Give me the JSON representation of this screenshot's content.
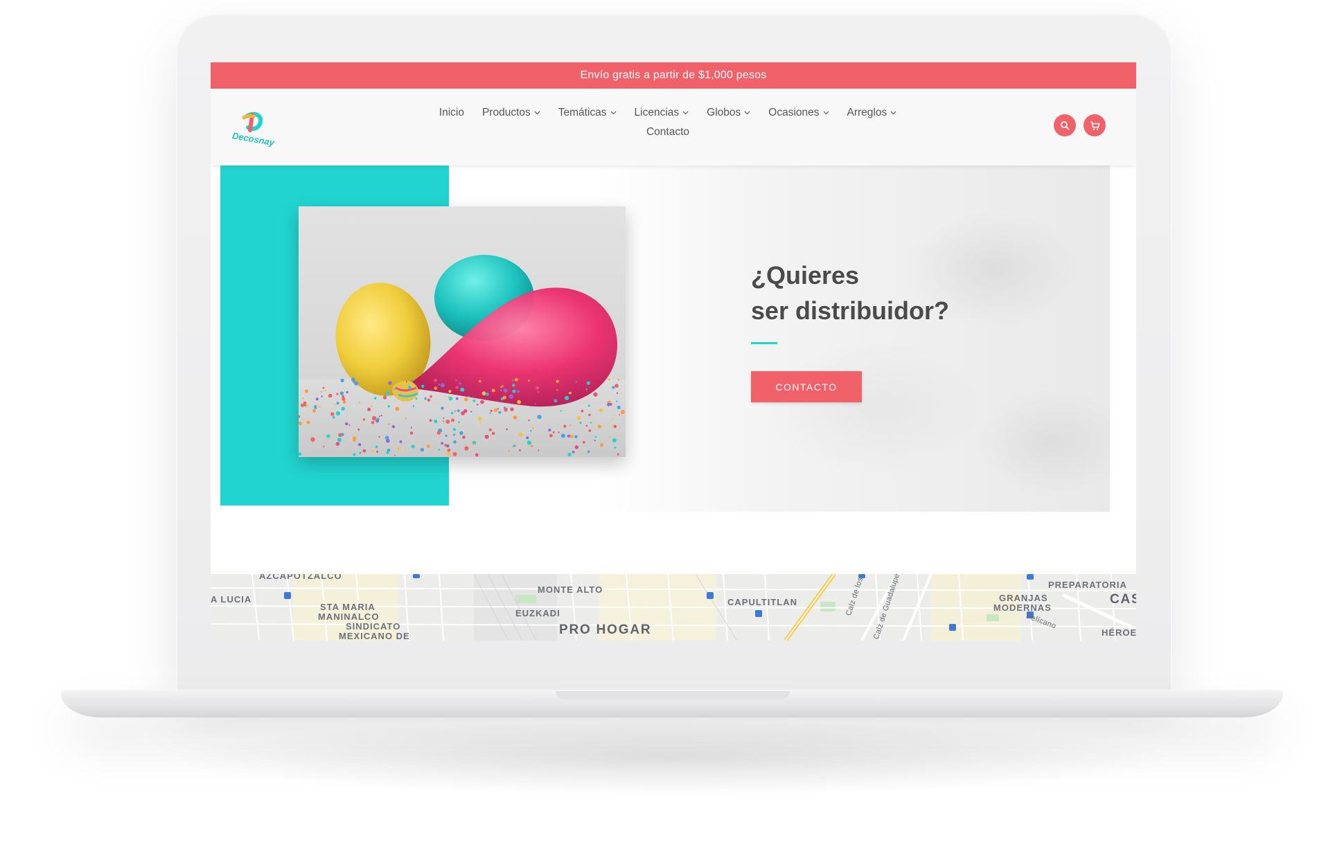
{
  "colors": {
    "accent_red": "#f0616a",
    "accent_teal": "#21d4cf",
    "header_bg": "#f8f8f8",
    "text_dark": "#4a4a4a"
  },
  "announcement": {
    "text": "Envío gratis a partir de $1,000 pesos"
  },
  "header": {
    "logo_text": "Decosnay",
    "nav": [
      {
        "label": "Inicio",
        "has_dropdown": false
      },
      {
        "label": "Productos",
        "has_dropdown": true
      },
      {
        "label": "Temáticas",
        "has_dropdown": true
      },
      {
        "label": "Licencias",
        "has_dropdown": true
      },
      {
        "label": "Globos",
        "has_dropdown": true
      },
      {
        "label": "Ocasiones",
        "has_dropdown": true
      },
      {
        "label": "Arreglos",
        "has_dropdown": true
      },
      {
        "label": "Contacto",
        "has_dropdown": false
      }
    ],
    "icons": [
      "search-icon",
      "cart-icon"
    ]
  },
  "hero": {
    "title_line1": "¿Quieres",
    "title_line2": "ser distribuidor?",
    "cta_label": "CONTACTO",
    "image": "balloons-confetti-photo"
  },
  "map": {
    "labels": [
      "AZCAPOTZALCO",
      "A LUCIA",
      "STA MARIA",
      "MANINALCO",
      "SINDICATO",
      "MEXICANO DE",
      "MONTE ALTO",
      "EUZKADI",
      "PRO HOGAR",
      "CAPULTITLAN",
      "Calz de los Misterios",
      "Calz de Guadalupe",
      "GRANJAS",
      "MODERNAS",
      "PREPARATORIA",
      "Pelícano",
      "CAS",
      "HÉROE"
    ]
  }
}
